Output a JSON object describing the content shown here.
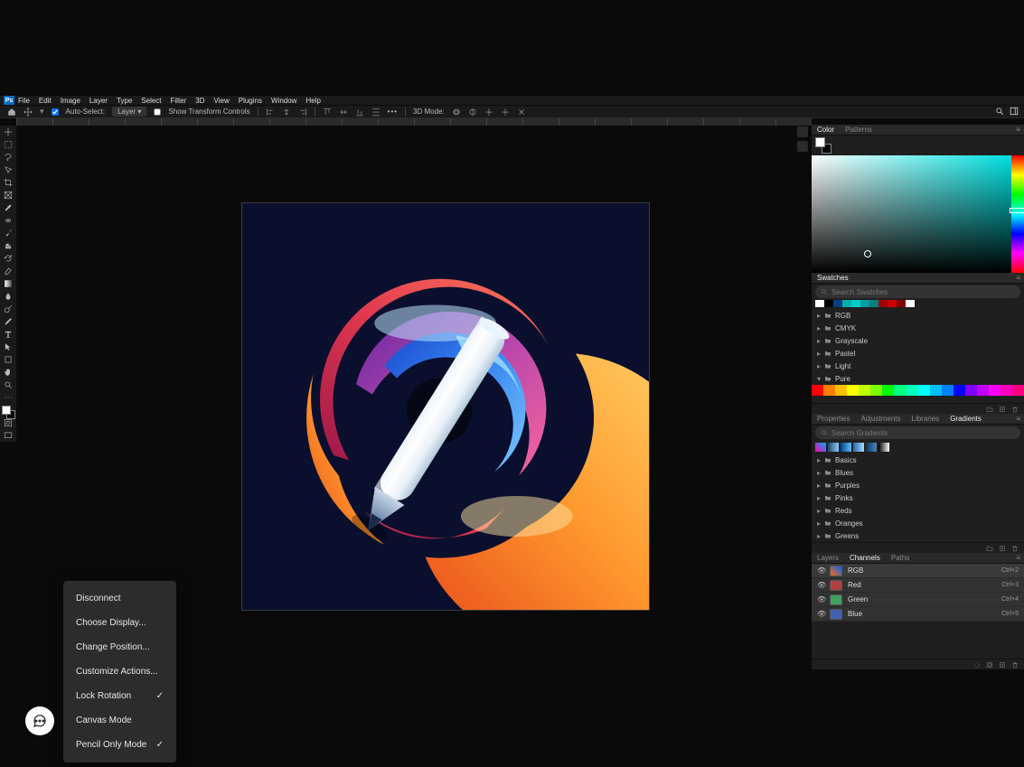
{
  "menubar": {
    "items": [
      "File",
      "Edit",
      "Image",
      "Layer",
      "Type",
      "Select",
      "Filter",
      "3D",
      "View",
      "Plugins",
      "Window",
      "Help"
    ]
  },
  "optionsbar": {
    "auto_select": "Auto-Select:",
    "layer": "Layer",
    "show_transform": "Show Transform Controls",
    "mode_3d": "3D Mode:"
  },
  "context_menu": {
    "items": [
      {
        "label": "Disconnect",
        "check": false
      },
      {
        "label": "Choose Display...",
        "check": false
      },
      {
        "label": "Change Position...",
        "check": false
      },
      {
        "label": "Customize Actions...",
        "check": false
      },
      {
        "label": "Lock Rotation",
        "check": true
      },
      {
        "label": "Canvas Mode",
        "check": false
      },
      {
        "label": "Pencil Only Mode",
        "check": true
      }
    ]
  },
  "panels": {
    "color_tab": "Color",
    "patterns_tab": "Patterns",
    "swatches_tab": "Swatches",
    "swatches_search": "Search Swatches",
    "swatch_folders": [
      "RGB",
      "CMYK",
      "Grayscale",
      "Pastel",
      "Light",
      "Pure"
    ],
    "properties_tab": "Properties",
    "adjustments_tab": "Adjustments",
    "libraries_tab": "Libraries",
    "gradients_tab": "Gradients",
    "gradients_search": "Search Gradients",
    "gradient_folders": [
      "Basics",
      "Blues",
      "Purples",
      "Pinks",
      "Reds",
      "Oranges",
      "Greens"
    ],
    "layers_tab": "Layers",
    "channels_tab": "Channels",
    "paths_tab": "Paths",
    "channels": [
      {
        "name": "RGB",
        "shortcut": "Ctrl+2"
      },
      {
        "name": "Red",
        "shortcut": "Ctrl+3"
      },
      {
        "name": "Green",
        "shortcut": "Ctrl+4"
      },
      {
        "name": "Blue",
        "shortcut": "Ctrl+5"
      }
    ]
  },
  "colors": {
    "pure": [
      "#ff0000",
      "#ff8000",
      "#ffbf00",
      "#ffff00",
      "#bfff00",
      "#80ff00",
      "#00ff00",
      "#00ff80",
      "#00ffbf",
      "#00ffff",
      "#00bfff",
      "#0080ff",
      "#0000ff",
      "#8000ff",
      "#bf00ff",
      "#ff00ff",
      "#ff00bf",
      "#ff0080"
    ],
    "swatches_top": [
      "#ffffff",
      "#000000",
      "#004080",
      "#00b0b0",
      "#00cccc",
      "#00a0a0",
      "#008080",
      "#a00000",
      "#cc0000",
      "#800000",
      "#ffffff"
    ]
  }
}
